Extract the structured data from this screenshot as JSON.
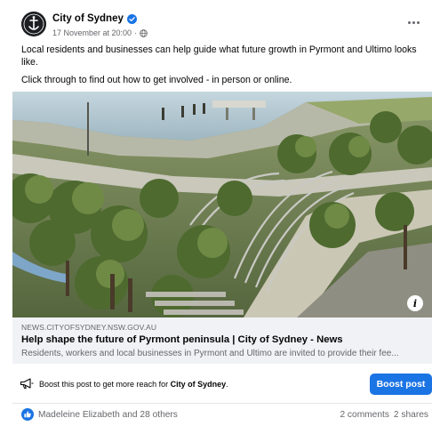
{
  "post": {
    "page_name": "City of Sydney",
    "timestamp": "17 November at 20:00",
    "separator": "·",
    "text_line1": "Local residents and businesses can help guide what future growth in Pyrmont and Ultimo looks like.",
    "text_line2": "Click through to find out how to get involved - in person or online."
  },
  "link_preview": {
    "domain": "NEWS.CITYOFSYDNEY.NSW.GOV.AU",
    "title": "Help shape the future of Pyrmont peninsula | City of Sydney - News",
    "description": "Residents, workers and local businesses in Pyrmont and Ultimo are invited to provide their fee..."
  },
  "boost": {
    "text_prefix": "Boost this post to get more reach for ",
    "page_name": "City of Sydney",
    "text_suffix": ".",
    "button_label": "Boost post"
  },
  "engagement": {
    "reactors": "Madeleine Elizabeth and 28 others",
    "comments": "2 comments",
    "shares": "2 shares"
  },
  "icons": {
    "verified": "verified-badge-icon",
    "audience": "globe-icon",
    "more": "more-options-icon",
    "info": "info-icon",
    "boost": "megaphone-icon",
    "like": "like-reaction-icon"
  },
  "colors": {
    "brand_blue": "#1b74e4",
    "secondary_text": "#65676b",
    "link_bg": "#f0f2f5"
  }
}
